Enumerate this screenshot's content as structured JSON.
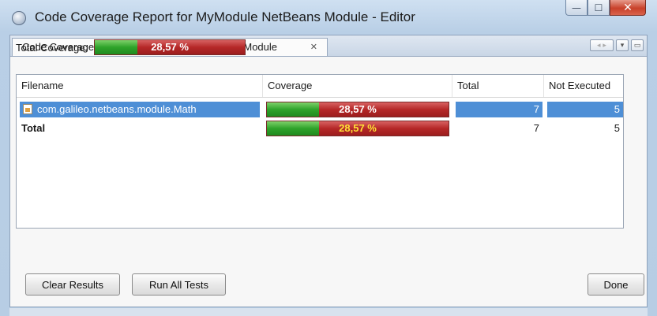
{
  "window": {
    "title": "Code Coverage Report for MyModule NetBeans Module - Editor",
    "controls": {
      "minimize": "—",
      "maximize": "☐",
      "close": "✕"
    }
  },
  "tab": {
    "label": "Code Coverage Report for MyModule NetBeans Module",
    "close": "✕",
    "controls": {
      "nav": "◂ ▸",
      "dropdown": "▾",
      "maximize": "▭"
    }
  },
  "summary": {
    "label": "Total Coverage:",
    "value": "28,57 %",
    "fraction": 0.2857
  },
  "table": {
    "headers": [
      "Filename",
      "Coverage",
      "Total",
      "Not Executed"
    ],
    "rows": [
      {
        "filename": "com.galileo.netbeans.module.Math",
        "coverage": "28,57 %",
        "fraction": 0.2857,
        "total": "7",
        "not_executed": "5",
        "selected": true
      }
    ],
    "total_row": {
      "label": "Total",
      "coverage": "28,57 %",
      "fraction": 0.2857,
      "total": "7",
      "not_executed": "5"
    }
  },
  "buttons": {
    "clear": "Clear Results",
    "run_all": "Run All Tests",
    "done": "Done"
  },
  "colors": {
    "covered": "#2fa32a",
    "uncovered": "#b52828",
    "selection": "#4e8fd6",
    "total_text": "#ffe135"
  }
}
